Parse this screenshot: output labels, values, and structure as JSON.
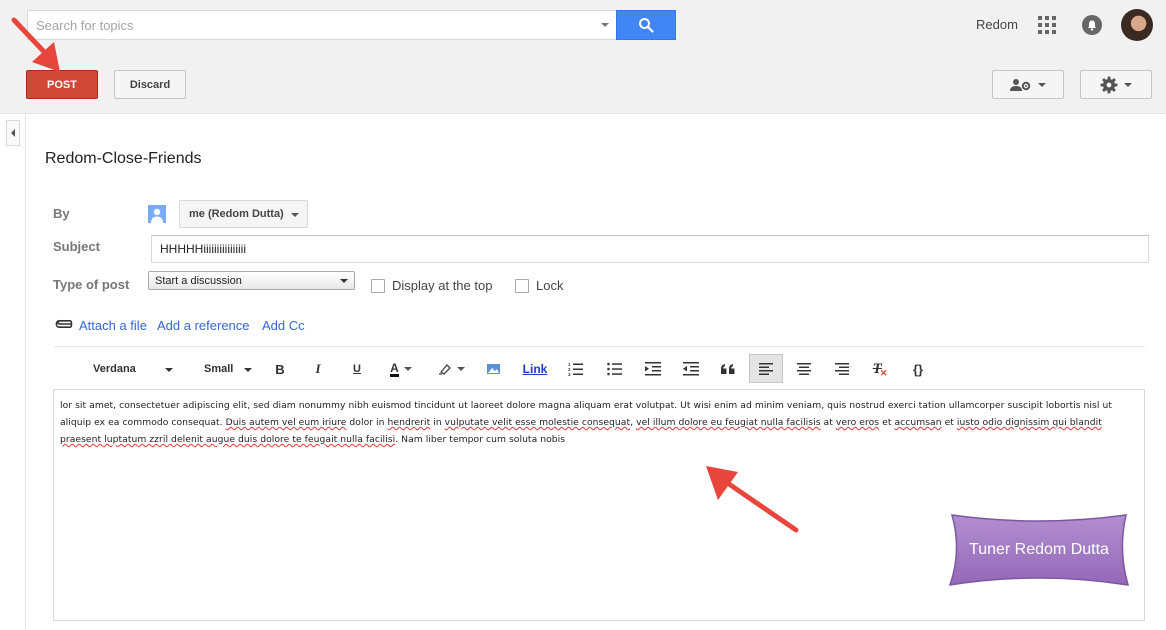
{
  "search": {
    "placeholder": "Search for topics"
  },
  "header": {
    "user_name": "Redom"
  },
  "actions": {
    "post_label": "POST",
    "discard_label": "Discard"
  },
  "group": {
    "title": "Redom-Close-Friends"
  },
  "form": {
    "by_label": "By",
    "by_value": "me (Redom Dutta)",
    "subject_label": "Subject",
    "subject_value": "HHHHHiiiiiiiiiiiiiiii",
    "type_label": "Type of post",
    "type_value": "Start a discussion",
    "display_top_label": "Display at the top",
    "lock_label": "Lock"
  },
  "links": {
    "attach": "Attach a file",
    "reference": "Add a reference",
    "cc": "Add Cc"
  },
  "toolbar": {
    "font": "Verdana",
    "size": "Small",
    "bold": "B",
    "italic": "I",
    "underline": "U",
    "text_color": "A",
    "link": "Link",
    "remove_format": "T",
    "code": "{}"
  },
  "editor": {
    "segments": [
      [
        "lor sit amet, consectetuer adipiscing elit, sed diam nonummy nibh euismod tincidunt ut laoreet dolore magna aliquam erat volutpat. Ut wisi enim ad minim veniam, quis nostrud exerci tation ullamcorper suscipit lobortis nisl ut aliquip ex ea commodo consequat. ",
        false
      ],
      [
        "Duis autem vel eum iriure",
        true
      ],
      [
        " dolor in ",
        false
      ],
      [
        "hendrerit",
        true
      ],
      [
        " in ",
        false
      ],
      [
        "vulputate velit esse molestie consequat",
        true
      ],
      [
        ", ",
        false
      ],
      [
        "vel illum dolore eu feugiat nulla facilisis",
        true
      ],
      [
        " at ",
        false
      ],
      [
        "vero eros",
        true
      ],
      [
        " et ",
        false
      ],
      [
        "accumsan",
        true
      ],
      [
        " et ",
        false
      ],
      [
        "iusto odio dignissim qui blandit praesent luptatum zzril delenit augue duis dolore te feugait nulla facilisi",
        true
      ],
      [
        ". Nam liber tempor cum soluta nobis",
        false
      ]
    ]
  },
  "watermark": {
    "text": "Tuner Redom Dutta"
  },
  "colors": {
    "post": "#d14836",
    "search_button": "#4285f4",
    "link": "#3367d6",
    "annotation_arrow": "#e8453c",
    "watermark_fill": "#a57cc4"
  },
  "icons": [
    "search-icon",
    "apps-grid-icon",
    "notification-bell-icon",
    "people-settings-icon",
    "gear-icon",
    "paperclip-icon",
    "bold-icon",
    "italic-icon",
    "underline-icon",
    "text-color-icon",
    "highlight-icon",
    "image-icon",
    "numbered-list-icon",
    "bulleted-list-icon",
    "indent-icon",
    "outdent-icon",
    "quote-icon",
    "align-left-icon",
    "align-center-icon",
    "align-right-icon",
    "remove-format-icon",
    "code-icon"
  ]
}
